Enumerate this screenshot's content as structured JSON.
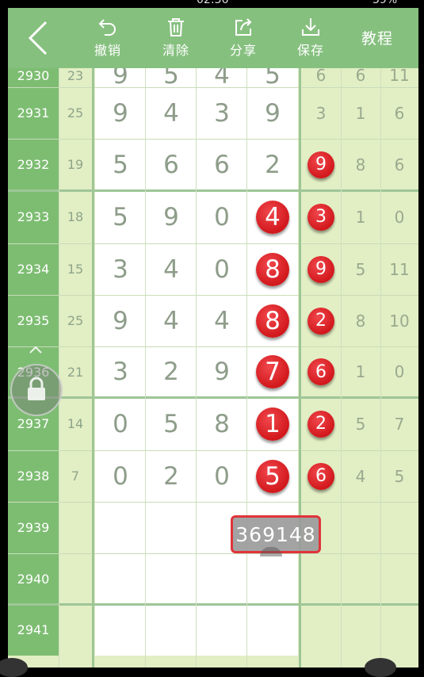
{
  "status_bar": {
    "time": "02:36",
    "battery": "39%"
  },
  "toolbar": {
    "undo_label": "撤销",
    "clear_label": "清除",
    "share_label": "分享",
    "save_label": "保存",
    "tutorial_label": "教程"
  },
  "colors": {
    "toolbar_green": "#86c07f",
    "issue_green": "#7dbd72",
    "stat_bg": "#e2eec4",
    "ball_red": "#e0262b"
  },
  "rows": [
    {
      "issue": "2930",
      "sum": "23",
      "draw": [
        "9",
        "5",
        "4",
        "5"
      ],
      "hit": [
        false,
        false,
        false,
        false
      ],
      "stats": [
        "6",
        "6",
        "11"
      ],
      "stat_hit": [
        false,
        false,
        false
      ]
    },
    {
      "issue": "2931",
      "sum": "25",
      "draw": [
        "9",
        "4",
        "3",
        "9"
      ],
      "hit": [
        false,
        false,
        false,
        false
      ],
      "stats": [
        "3",
        "1",
        "6"
      ],
      "stat_hit": [
        false,
        false,
        false
      ]
    },
    {
      "issue": "2932",
      "sum": "19",
      "draw": [
        "5",
        "6",
        "6",
        "2"
      ],
      "hit": [
        false,
        false,
        false,
        false
      ],
      "stats": [
        "9",
        "8",
        "6"
      ],
      "stat_hit": [
        true,
        false,
        false
      ]
    },
    {
      "issue": "2933",
      "sum": "18",
      "draw": [
        "5",
        "9",
        "0",
        "4"
      ],
      "hit": [
        false,
        false,
        false,
        true
      ],
      "stats": [
        "3",
        "1",
        "0"
      ],
      "stat_hit": [
        true,
        false,
        false
      ]
    },
    {
      "issue": "2934",
      "sum": "15",
      "draw": [
        "3",
        "4",
        "0",
        "8"
      ],
      "hit": [
        false,
        false,
        false,
        true
      ],
      "stats": [
        "9",
        "5",
        "11"
      ],
      "stat_hit": [
        true,
        false,
        false
      ]
    },
    {
      "issue": "2935",
      "sum": "25",
      "draw": [
        "9",
        "4",
        "4",
        "8"
      ],
      "hit": [
        false,
        false,
        false,
        true
      ],
      "stats": [
        "2",
        "8",
        "10"
      ],
      "stat_hit": [
        true,
        false,
        false
      ]
    },
    {
      "issue": "2936",
      "sum": "21",
      "draw": [
        "3",
        "2",
        "9",
        "7"
      ],
      "hit": [
        false,
        false,
        false,
        true
      ],
      "stats": [
        "6",
        "1",
        "0"
      ],
      "stat_hit": [
        true,
        false,
        false
      ]
    },
    {
      "issue": "2937",
      "sum": "14",
      "draw": [
        "0",
        "5",
        "8",
        "1"
      ],
      "hit": [
        false,
        false,
        false,
        true
      ],
      "stats": [
        "2",
        "5",
        "7"
      ],
      "stat_hit": [
        true,
        false,
        false
      ]
    },
    {
      "issue": "2938",
      "sum": "7",
      "draw": [
        "0",
        "2",
        "0",
        "5"
      ],
      "hit": [
        false,
        false,
        false,
        true
      ],
      "stats": [
        "6",
        "4",
        "5"
      ],
      "stat_hit": [
        true,
        false,
        false
      ]
    },
    {
      "issue": "2939",
      "sum": "",
      "draw": [
        "",
        "",
        "",
        ""
      ],
      "hit": [
        false,
        false,
        false,
        false
      ],
      "stats": [
        "",
        "",
        ""
      ],
      "stat_hit": [
        false,
        false,
        false
      ]
    },
    {
      "issue": "2940",
      "sum": "",
      "draw": [
        "",
        "",
        "",
        ""
      ],
      "hit": [
        false,
        false,
        false,
        false
      ],
      "stats": [
        "",
        "",
        ""
      ],
      "stat_hit": [
        false,
        false,
        false
      ]
    },
    {
      "issue": "2941",
      "sum": "",
      "draw": [
        "",
        "",
        "",
        ""
      ],
      "hit": [
        false,
        false,
        false,
        false
      ],
      "stats": [
        "",
        "",
        ""
      ],
      "stat_hit": [
        false,
        false,
        false
      ]
    }
  ],
  "popup": {
    "value": "369148"
  }
}
